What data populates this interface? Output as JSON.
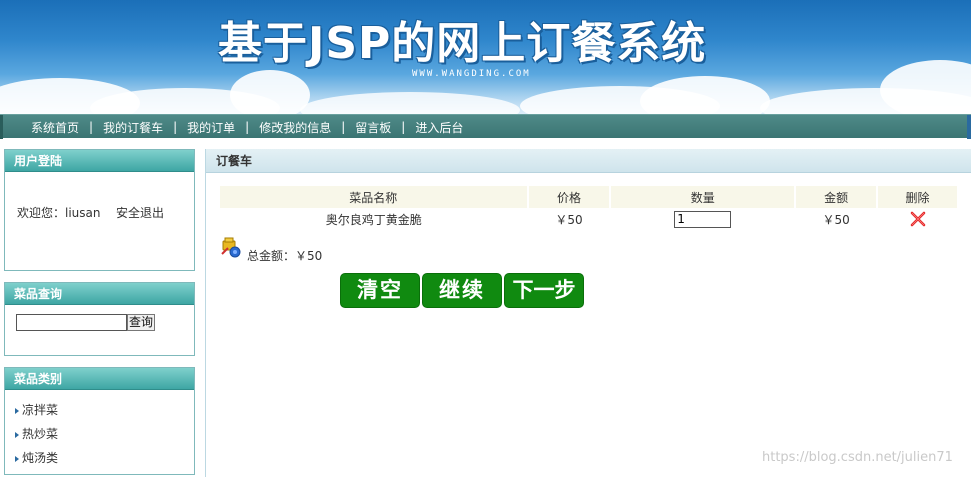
{
  "banner": {
    "title": "基于JSP的网上订餐系统",
    "subtitle": "WWW.WANGDING.COM"
  },
  "nav": {
    "items": [
      "系统首页",
      "我的订餐车",
      "我的订单",
      "修改我的信息",
      "留言板",
      "进入后台"
    ],
    "separator": "|"
  },
  "login_box": {
    "title": "用户登陆",
    "welcome": "欢迎您：liusan",
    "logout": "安全退出"
  },
  "search_box": {
    "title": "菜品查询",
    "input_value": "",
    "button": "查询"
  },
  "category_box": {
    "title": "菜品类别",
    "items": [
      "凉拌菜",
      "热炒菜",
      "炖汤类"
    ]
  },
  "main": {
    "title": "订餐车",
    "table": {
      "headers": [
        "菜品名称",
        "价格",
        "数量",
        "金额",
        "删除"
      ],
      "rows": [
        {
          "name": "奥尔良鸡丁黄金脆",
          "price": "￥50",
          "quantity": "1",
          "amount": "￥50"
        }
      ]
    },
    "total": "总金额：￥50",
    "buttons": {
      "clear": "清空",
      "continue": "继续",
      "next": "下一步"
    }
  },
  "watermark": "https://blog.csdn.net/julien71",
  "colors": {
    "nav_bg": "#3b7573",
    "side_head": "#3ea6a4",
    "button_green": "#108a10",
    "delete_red": "#e02020"
  }
}
